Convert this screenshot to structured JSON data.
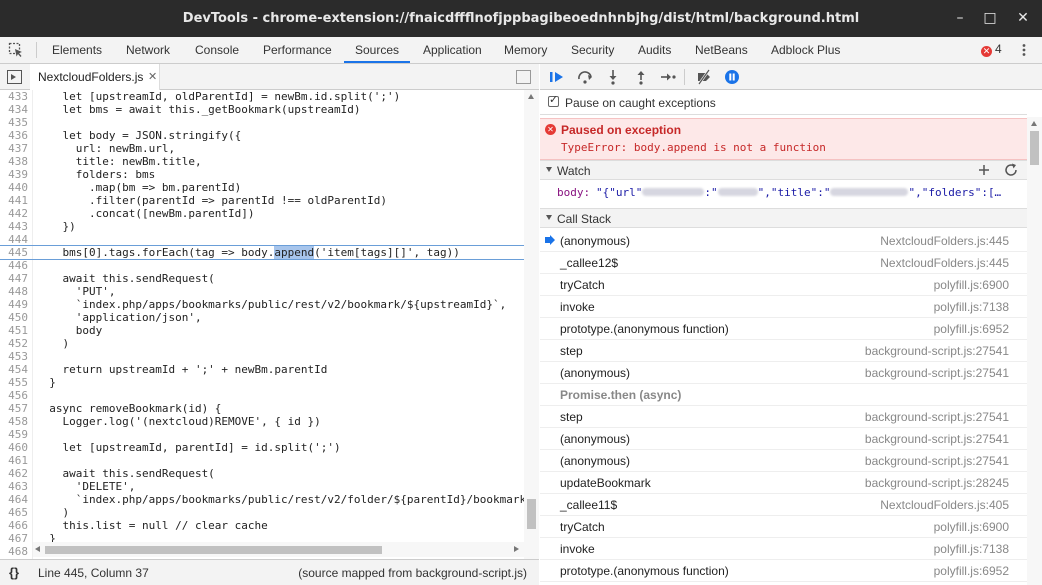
{
  "window": {
    "title": "DevTools - chrome-extension://fnaicdffflnofjppbagibeoednhnbjhg/dist/html/background.html",
    "minimize": "–",
    "maximize": "□",
    "close": "✕"
  },
  "tabs": [
    {
      "label": "Elements"
    },
    {
      "label": "Network"
    },
    {
      "label": "Console"
    },
    {
      "label": "Performance"
    },
    {
      "label": "Sources"
    },
    {
      "label": "Application"
    },
    {
      "label": "Memory"
    },
    {
      "label": "Security"
    },
    {
      "label": "Audits"
    },
    {
      "label": "NetBeans"
    },
    {
      "label": "Adblock Plus"
    }
  ],
  "active_tab": "Sources",
  "errors": {
    "icon": "✕",
    "count": "4"
  },
  "editor": {
    "file_tab": "NextcloudFolders.js",
    "file_tab_close": "✕",
    "status": {
      "braces": "{}",
      "position": "Line 445, Column 37",
      "mapped": "(source mapped from background-script.js)"
    }
  },
  "code_lines": [
    {
      "num": "433",
      "text": "    let [upstreamId, oldParentId] = newBm.id.split(';')"
    },
    {
      "num": "434",
      "text": "    let bms = await this._getBookmark(upstreamId)"
    },
    {
      "num": "435",
      "text": ""
    },
    {
      "num": "436",
      "text": "    let body = JSON.stringify({"
    },
    {
      "num": "437",
      "text": "      url: newBm.url,"
    },
    {
      "num": "438",
      "text": "      title: newBm.title,"
    },
    {
      "num": "439",
      "text": "      folders: bms"
    },
    {
      "num": "440",
      "text": "        .map(bm => bm.parentId)"
    },
    {
      "num": "441",
      "text": "        .filter(parentId => parentId !== oldParentId)"
    },
    {
      "num": "442",
      "text": "        .concat([newBm.parentId])"
    },
    {
      "num": "443",
      "text": "    })"
    },
    {
      "num": "444",
      "text": ""
    },
    {
      "num": "445",
      "text": "    bms[0].tags.forEach(tag => body.append('item[tags][]', tag))"
    },
    {
      "num": "446",
      "text": ""
    },
    {
      "num": "447",
      "text": "    await this.sendRequest("
    },
    {
      "num": "448",
      "text": "      'PUT',"
    },
    {
      "num": "449",
      "text": "      `index.php/apps/bookmarks/public/rest/v2/bookmark/${upstreamId}`,"
    },
    {
      "num": "450",
      "text": "      'application/json',"
    },
    {
      "num": "451",
      "text": "      body"
    },
    {
      "num": "452",
      "text": "    )"
    },
    {
      "num": "453",
      "text": ""
    },
    {
      "num": "454",
      "text": "    return upstreamId + ';' + newBm.parentId"
    },
    {
      "num": "455",
      "text": "  }"
    },
    {
      "num": "456",
      "text": ""
    },
    {
      "num": "457",
      "text": "  async removeBookmark(id) {"
    },
    {
      "num": "458",
      "text": "    Logger.log('(nextcloud)REMOVE', { id })"
    },
    {
      "num": "459",
      "text": ""
    },
    {
      "num": "460",
      "text": "    let [upstreamId, parentId] = id.split(';')"
    },
    {
      "num": "461",
      "text": ""
    },
    {
      "num": "462",
      "text": "    await this.sendRequest("
    },
    {
      "num": "463",
      "text": "      'DELETE',"
    },
    {
      "num": "464",
      "text": "      `index.php/apps/bookmarks/public/rest/v2/folder/${parentId}/bookmark"
    },
    {
      "num": "465",
      "text": "    )"
    },
    {
      "num": "466",
      "text": "    this.list = null // clear cache"
    },
    {
      "num": "467",
      "text": "  }"
    },
    {
      "num": "468",
      "text": ""
    }
  ],
  "current_line_index": 12,
  "debugger": {
    "pause_caught": "Pause on caught exceptions",
    "paused_title": "Paused on exception",
    "paused_message": "TypeError: body.append is not a function",
    "watch_title": "Watch",
    "watch_add": "+",
    "watch_refresh": "↻",
    "watch_key": "body:",
    "watch_value_parts": [
      "\"{\"url\"",
      ":\"",
      "\",\"title\":\"",
      "\",\"folders\":[…"
    ],
    "callstack_title": "Call Stack",
    "frames": [
      {
        "fn": "(anonymous)",
        "loc": "NextcloudFolders.js:445",
        "current": true
      },
      {
        "fn": "_callee12$",
        "loc": "NextcloudFolders.js:445"
      },
      {
        "fn": "tryCatch",
        "loc": "polyfill.js:6900"
      },
      {
        "fn": "invoke",
        "loc": "polyfill.js:7138"
      },
      {
        "fn": "prototype.(anonymous function)",
        "loc": "polyfill.js:6952"
      },
      {
        "fn": "step",
        "loc": "background-script.js:27541"
      },
      {
        "fn": "(anonymous)",
        "loc": "background-script.js:27541"
      },
      {
        "fn": "Promise.then (async)",
        "loc": "",
        "async": true
      },
      {
        "fn": "step",
        "loc": "background-script.js:27541"
      },
      {
        "fn": "(anonymous)",
        "loc": "background-script.js:27541"
      },
      {
        "fn": "(anonymous)",
        "loc": "background-script.js:27541"
      },
      {
        "fn": "updateBookmark",
        "loc": "background-script.js:28245"
      },
      {
        "fn": "_callee11$",
        "loc": "NextcloudFolders.js:405"
      },
      {
        "fn": "tryCatch",
        "loc": "polyfill.js:6900"
      },
      {
        "fn": "invoke",
        "loc": "polyfill.js:7138"
      },
      {
        "fn": "prototype.(anonymous function)",
        "loc": "polyfill.js:6952"
      }
    ]
  },
  "colors": {
    "accent": "#1a73e8",
    "error": "#c62828",
    "error_bg": "#fde8e8",
    "titlebar": "#2b2b2b"
  }
}
